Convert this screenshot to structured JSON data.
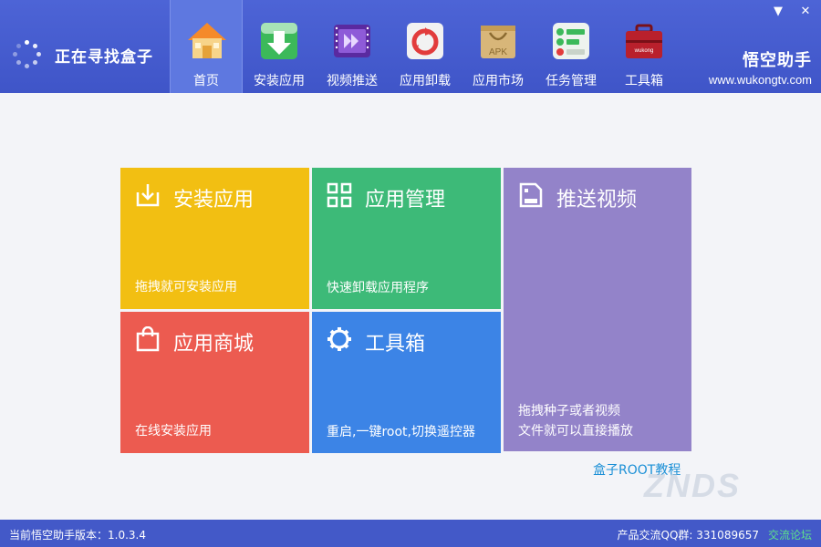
{
  "header": {
    "status_text": "正在寻找盒子",
    "brand_name": "悟空助手",
    "brand_url": "www.wukongtv.com",
    "window_controls": {
      "menu_icon": "▼",
      "close_icon": "✕"
    }
  },
  "nav": [
    {
      "label": "首页",
      "icon": "home-icon",
      "active": true
    },
    {
      "label": "安装应用",
      "icon": "install-icon"
    },
    {
      "label": "视频推送",
      "icon": "video-push-icon"
    },
    {
      "label": "应用卸载",
      "icon": "uninstall-icon"
    },
    {
      "label": "应用市场",
      "icon": "apk-market-icon"
    },
    {
      "label": "任务管理",
      "icon": "task-manager-icon"
    },
    {
      "label": "工具箱",
      "icon": "toolbox-icon"
    }
  ],
  "icon_badge_text": {
    "apk": "APK",
    "toolbox": "wukong"
  },
  "tiles": {
    "install": {
      "title": "安装应用",
      "desc": "拖拽就可安装应用",
      "color": "#f2bf12"
    },
    "manage": {
      "title": "应用管理",
      "desc": "快速卸载应用程序",
      "color": "#3dba78"
    },
    "video": {
      "title": "推送视频",
      "desc_line1": "拖拽种子或者视频",
      "desc_line2": "文件就可以直接播放",
      "color": "#9383c9"
    },
    "store": {
      "title": "应用商城",
      "desc": "在线安装应用",
      "color": "#ec5b50"
    },
    "tools": {
      "title": "工具箱",
      "desc": "重启,一键root,切换遥控器",
      "color": "#3c84e6"
    }
  },
  "root_link": "盒子ROOT教程",
  "watermark": "ZNDS",
  "footer": {
    "version": "当前悟空助手版本：1.0.3.4",
    "qq_group": "产品交流QQ群: 331089657",
    "forum_link": "交流论坛"
  }
}
